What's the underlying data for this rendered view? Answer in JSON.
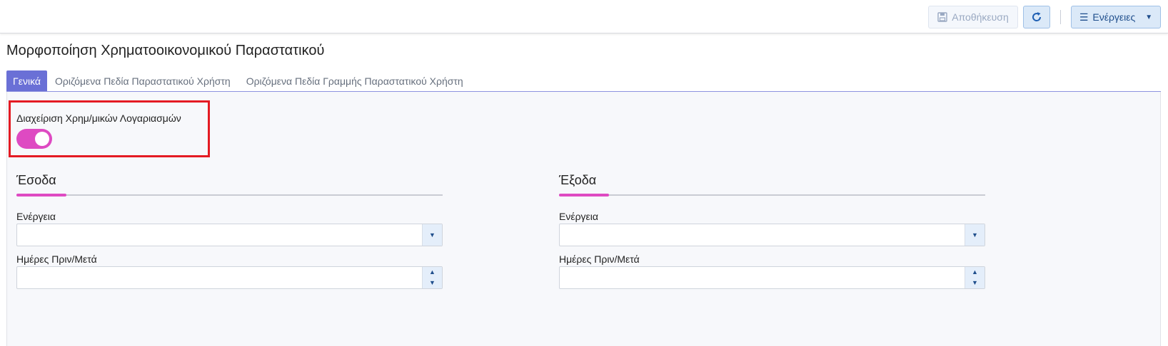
{
  "toolbar": {
    "save_label": "Αποθήκευση",
    "save_icon": "save-icon",
    "refresh_icon": "refresh-icon",
    "actions_label": "Ενέργειες",
    "actions_icon": "hamburger-icon",
    "actions_caret": "▼"
  },
  "page": {
    "title": "Μορφοποίηση Χρηματοοικονομικού Παραστατικού"
  },
  "tabs": [
    {
      "label": "Γενικά",
      "active": true
    },
    {
      "label": "Οριζόμενα Πεδία Παραστατικού Χρήστη",
      "active": false
    },
    {
      "label": "Οριζόμενα Πεδία Γραμμής Παραστατικού Χρήστη",
      "active": false
    }
  ],
  "toggle": {
    "label": "Διαχείριση Χρημ/μικών Λογαριασμών",
    "on": true,
    "color": "#de4ac2"
  },
  "highlight": {
    "color": "#e41b23"
  },
  "income": {
    "title": "Έσοδα",
    "action_label": "Ενέργεια",
    "action_value": "",
    "days_label": "Ημέρες Πριν/Μετά",
    "days_value": ""
  },
  "expense": {
    "title": "Έξοδα",
    "action_label": "Ενέργεια",
    "action_value": "",
    "days_label": "Ημέρες Πριν/Μετά",
    "days_value": ""
  },
  "colors": {
    "accent": "#de4ac2",
    "tab_active": "#6a70d6",
    "button_blue": "#dbe9f8"
  }
}
